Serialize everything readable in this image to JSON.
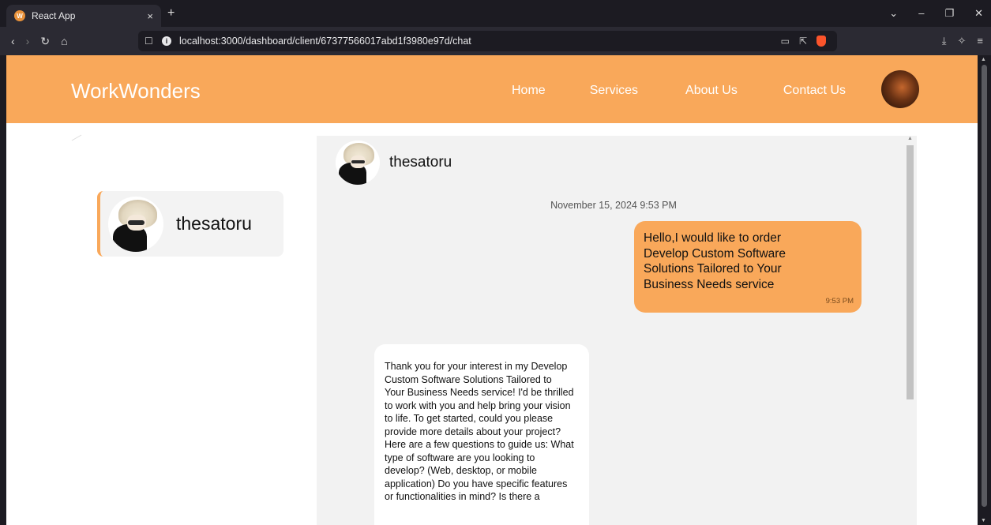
{
  "browser": {
    "tab_title": "React App",
    "tab_close": "×",
    "new_tab": "+",
    "url": "localhost:3000/dashboard/client/67377566017abd1f3980e97d/chat",
    "info_icon": "i",
    "favicon_letter": "W"
  },
  "site": {
    "brand": "WorkWonders",
    "nav": {
      "home": "Home",
      "services": "Services",
      "about": "About Us",
      "contact": "Contact Us"
    }
  },
  "sidebar": {
    "contact_name": "thesatoru"
  },
  "chat": {
    "header_name": "thesatoru",
    "date_separator": "November 15, 2024 9:53 PM",
    "messages": [
      {
        "direction": "outgoing",
        "text": "Hello,I would like to order Develop Custom Software Solutions Tailored to Your Business Needs service",
        "time": "9:53 PM"
      },
      {
        "direction": "incoming",
        "text": "Thank you for your interest in my Develop Custom Software Solutions Tailored to Your Business Needs service! I'd be thrilled to work with you and help bring your vision to life. To get started, could you please provide more details about your project? Here are a few questions to guide us: What type of software are you looking to develop? (Web, desktop, or mobile application) Do you have specific features or functionalities in mind? Is there a"
      }
    ]
  },
  "colors": {
    "accent": "#f9a85a",
    "chat_bg": "#f2f2f2",
    "browser_bg": "#1c1b22"
  },
  "icons": [
    "favicon-icon",
    "close-tab-icon",
    "new-tab-icon",
    "back-icon",
    "forward-icon",
    "reload-icon",
    "home-icon",
    "bookmark-icon",
    "site-info-icon",
    "cast-icon",
    "share-icon",
    "brave-shield-icon",
    "download-icon",
    "extensions-icon",
    "menu-icon",
    "tab-list-icon",
    "minimize-icon",
    "maximize-icon",
    "close-window-icon"
  ]
}
